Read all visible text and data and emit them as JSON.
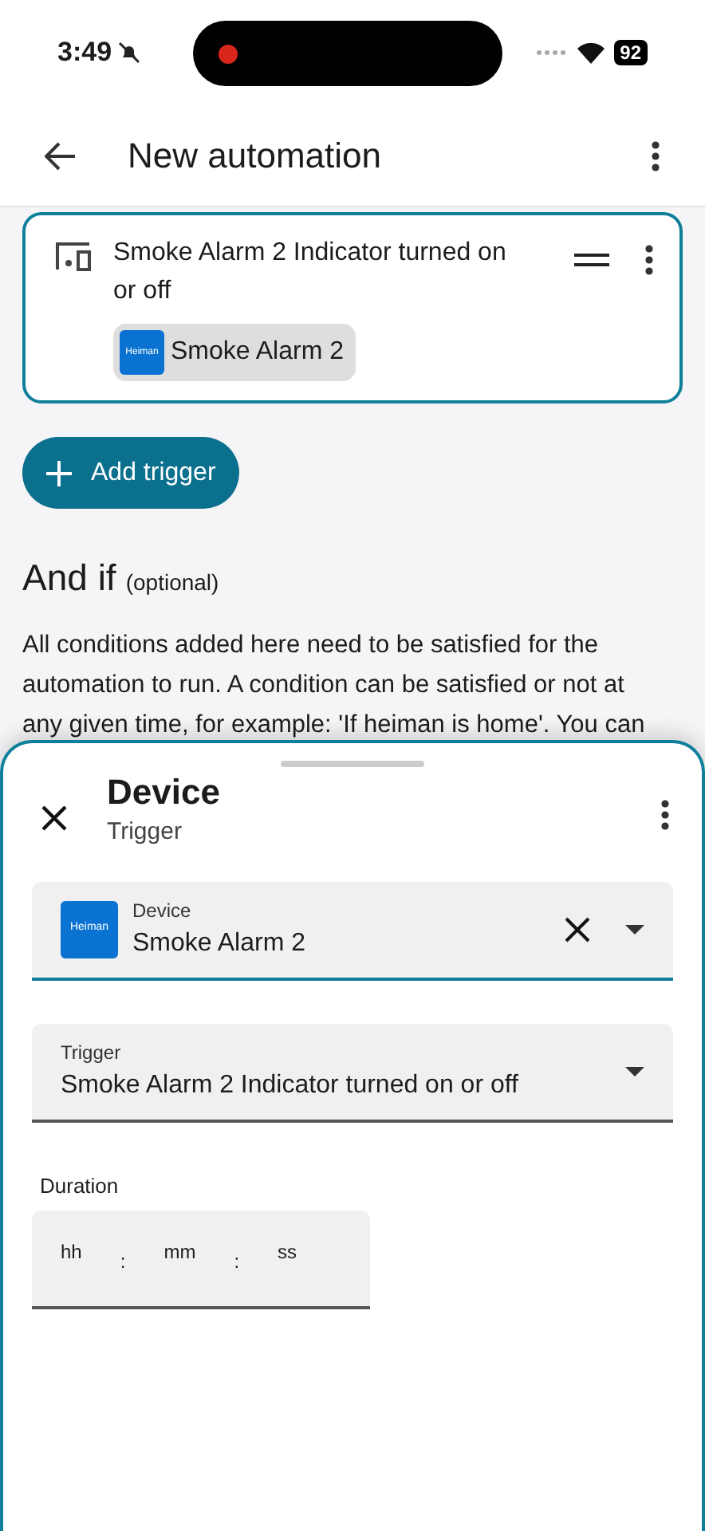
{
  "status_bar": {
    "time": "3:49",
    "battery": "92"
  },
  "header": {
    "title": "New automation"
  },
  "trigger_card": {
    "title": "Smoke Alarm 2 Indicator turned on or off",
    "device_chip": {
      "logo": "Heiman",
      "label": "Smoke Alarm 2"
    }
  },
  "add_trigger_button": {
    "label": "Add trigger"
  },
  "conditions": {
    "heading": "And if",
    "note": "(optional)",
    "description": "All conditions added here need to be satisfied for the automation to run. A condition can be satisfied or not at any given time, for example: 'If heiman is home'. You can"
  },
  "sheet": {
    "title": "Device",
    "subtitle": "Trigger",
    "fields": [
      {
        "kind": "device",
        "label": "Device",
        "logo": "Heiman",
        "value": "Smoke Alarm 2",
        "focused": true
      },
      {
        "kind": "select",
        "label": "Trigger",
        "value": "Smoke Alarm 2 Indicator turned on or off",
        "focused": false
      }
    ],
    "duration": {
      "label": "Duration",
      "parts": [
        "hh",
        "mm",
        "ss"
      ],
      "separator": ":"
    }
  }
}
